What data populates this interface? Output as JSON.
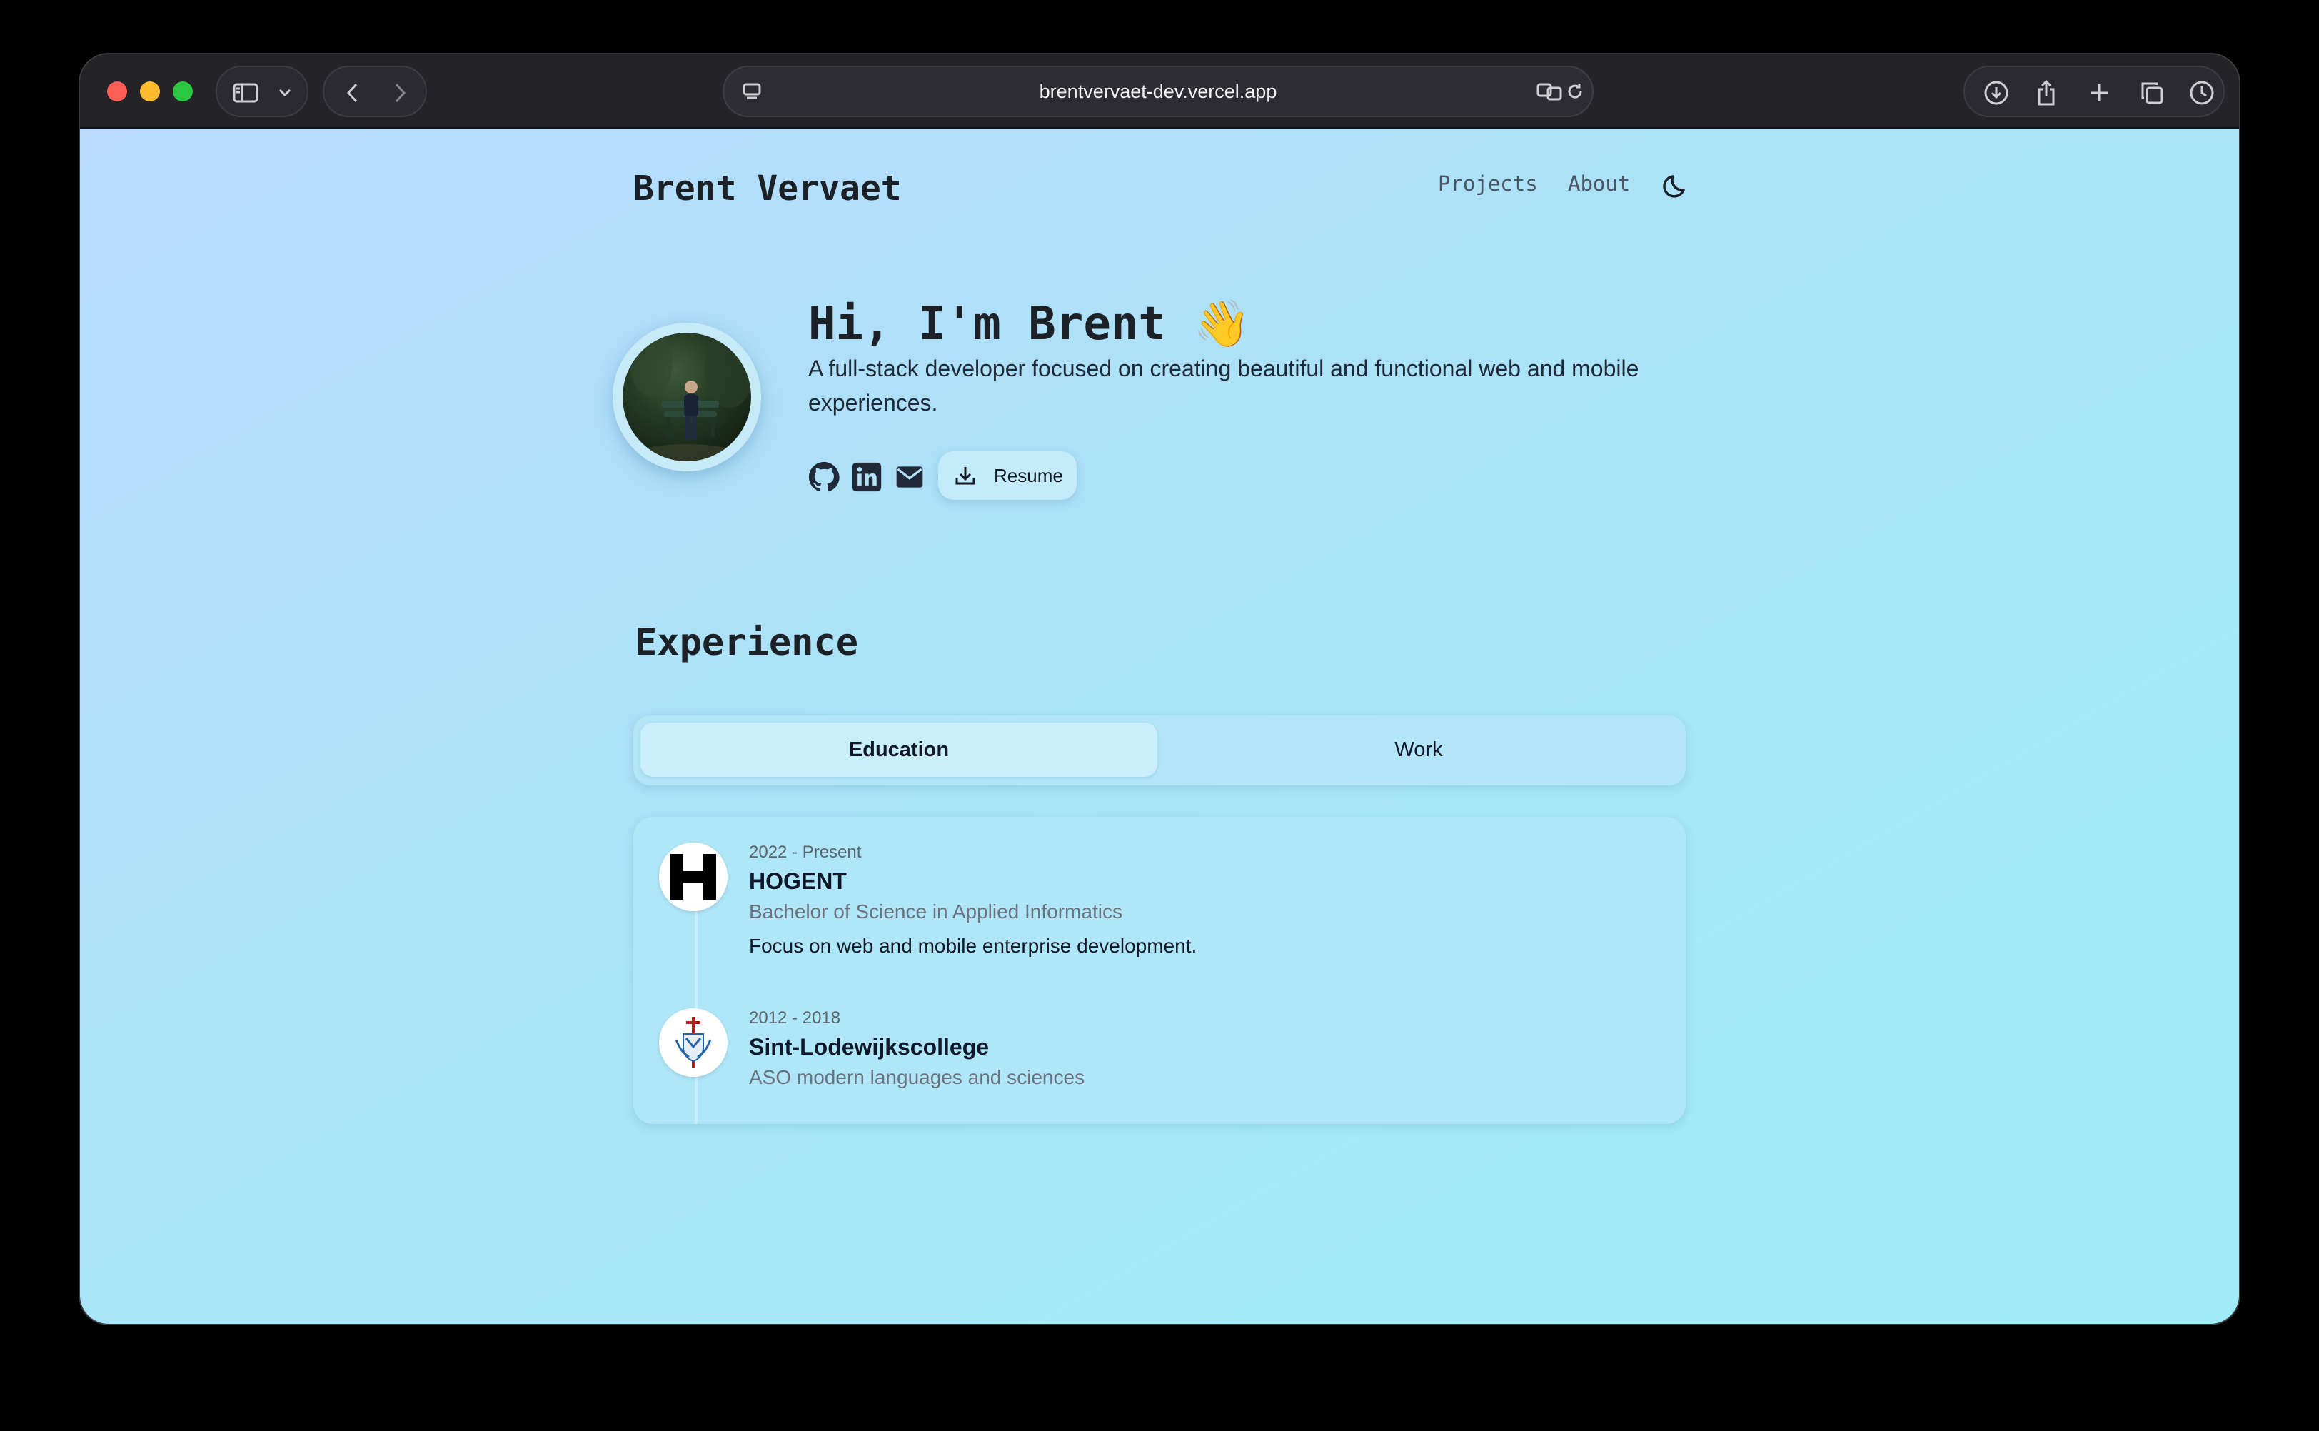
{
  "browser": {
    "url": "brentvervaet-dev.vercel.app"
  },
  "header": {
    "brand": "Brent Vervaet",
    "nav": [
      {
        "label": "Projects"
      },
      {
        "label": "About"
      }
    ],
    "theme_toggle_icon": "moon-icon"
  },
  "hero": {
    "title": "Hi, I'm Brent 👋",
    "description": "A full-stack developer focused on creating beautiful and functional web and mobile experiences.",
    "socials": [
      "github-icon",
      "linkedin-icon",
      "mail-icon"
    ],
    "resume_label": "Resume"
  },
  "experience": {
    "title": "Experience",
    "tabs": [
      {
        "label": "Education",
        "active": true
      },
      {
        "label": "Work",
        "active": false
      }
    ],
    "items": [
      {
        "date": "2022 - Present",
        "school": "HOGENT",
        "degree": "Bachelor of Science in Applied Informatics",
        "description": "Focus on web and mobile enterprise development."
      },
      {
        "date": "2012 - 2018",
        "school": "Sint-Lodewijkscollege",
        "degree": "ASO modern languages and sciences",
        "description": ""
      }
    ]
  },
  "colors": {
    "page_gradient_start": "#b9dbfd",
    "page_gradient_end": "#9fecf6",
    "text_dark": "#1b2127"
  }
}
